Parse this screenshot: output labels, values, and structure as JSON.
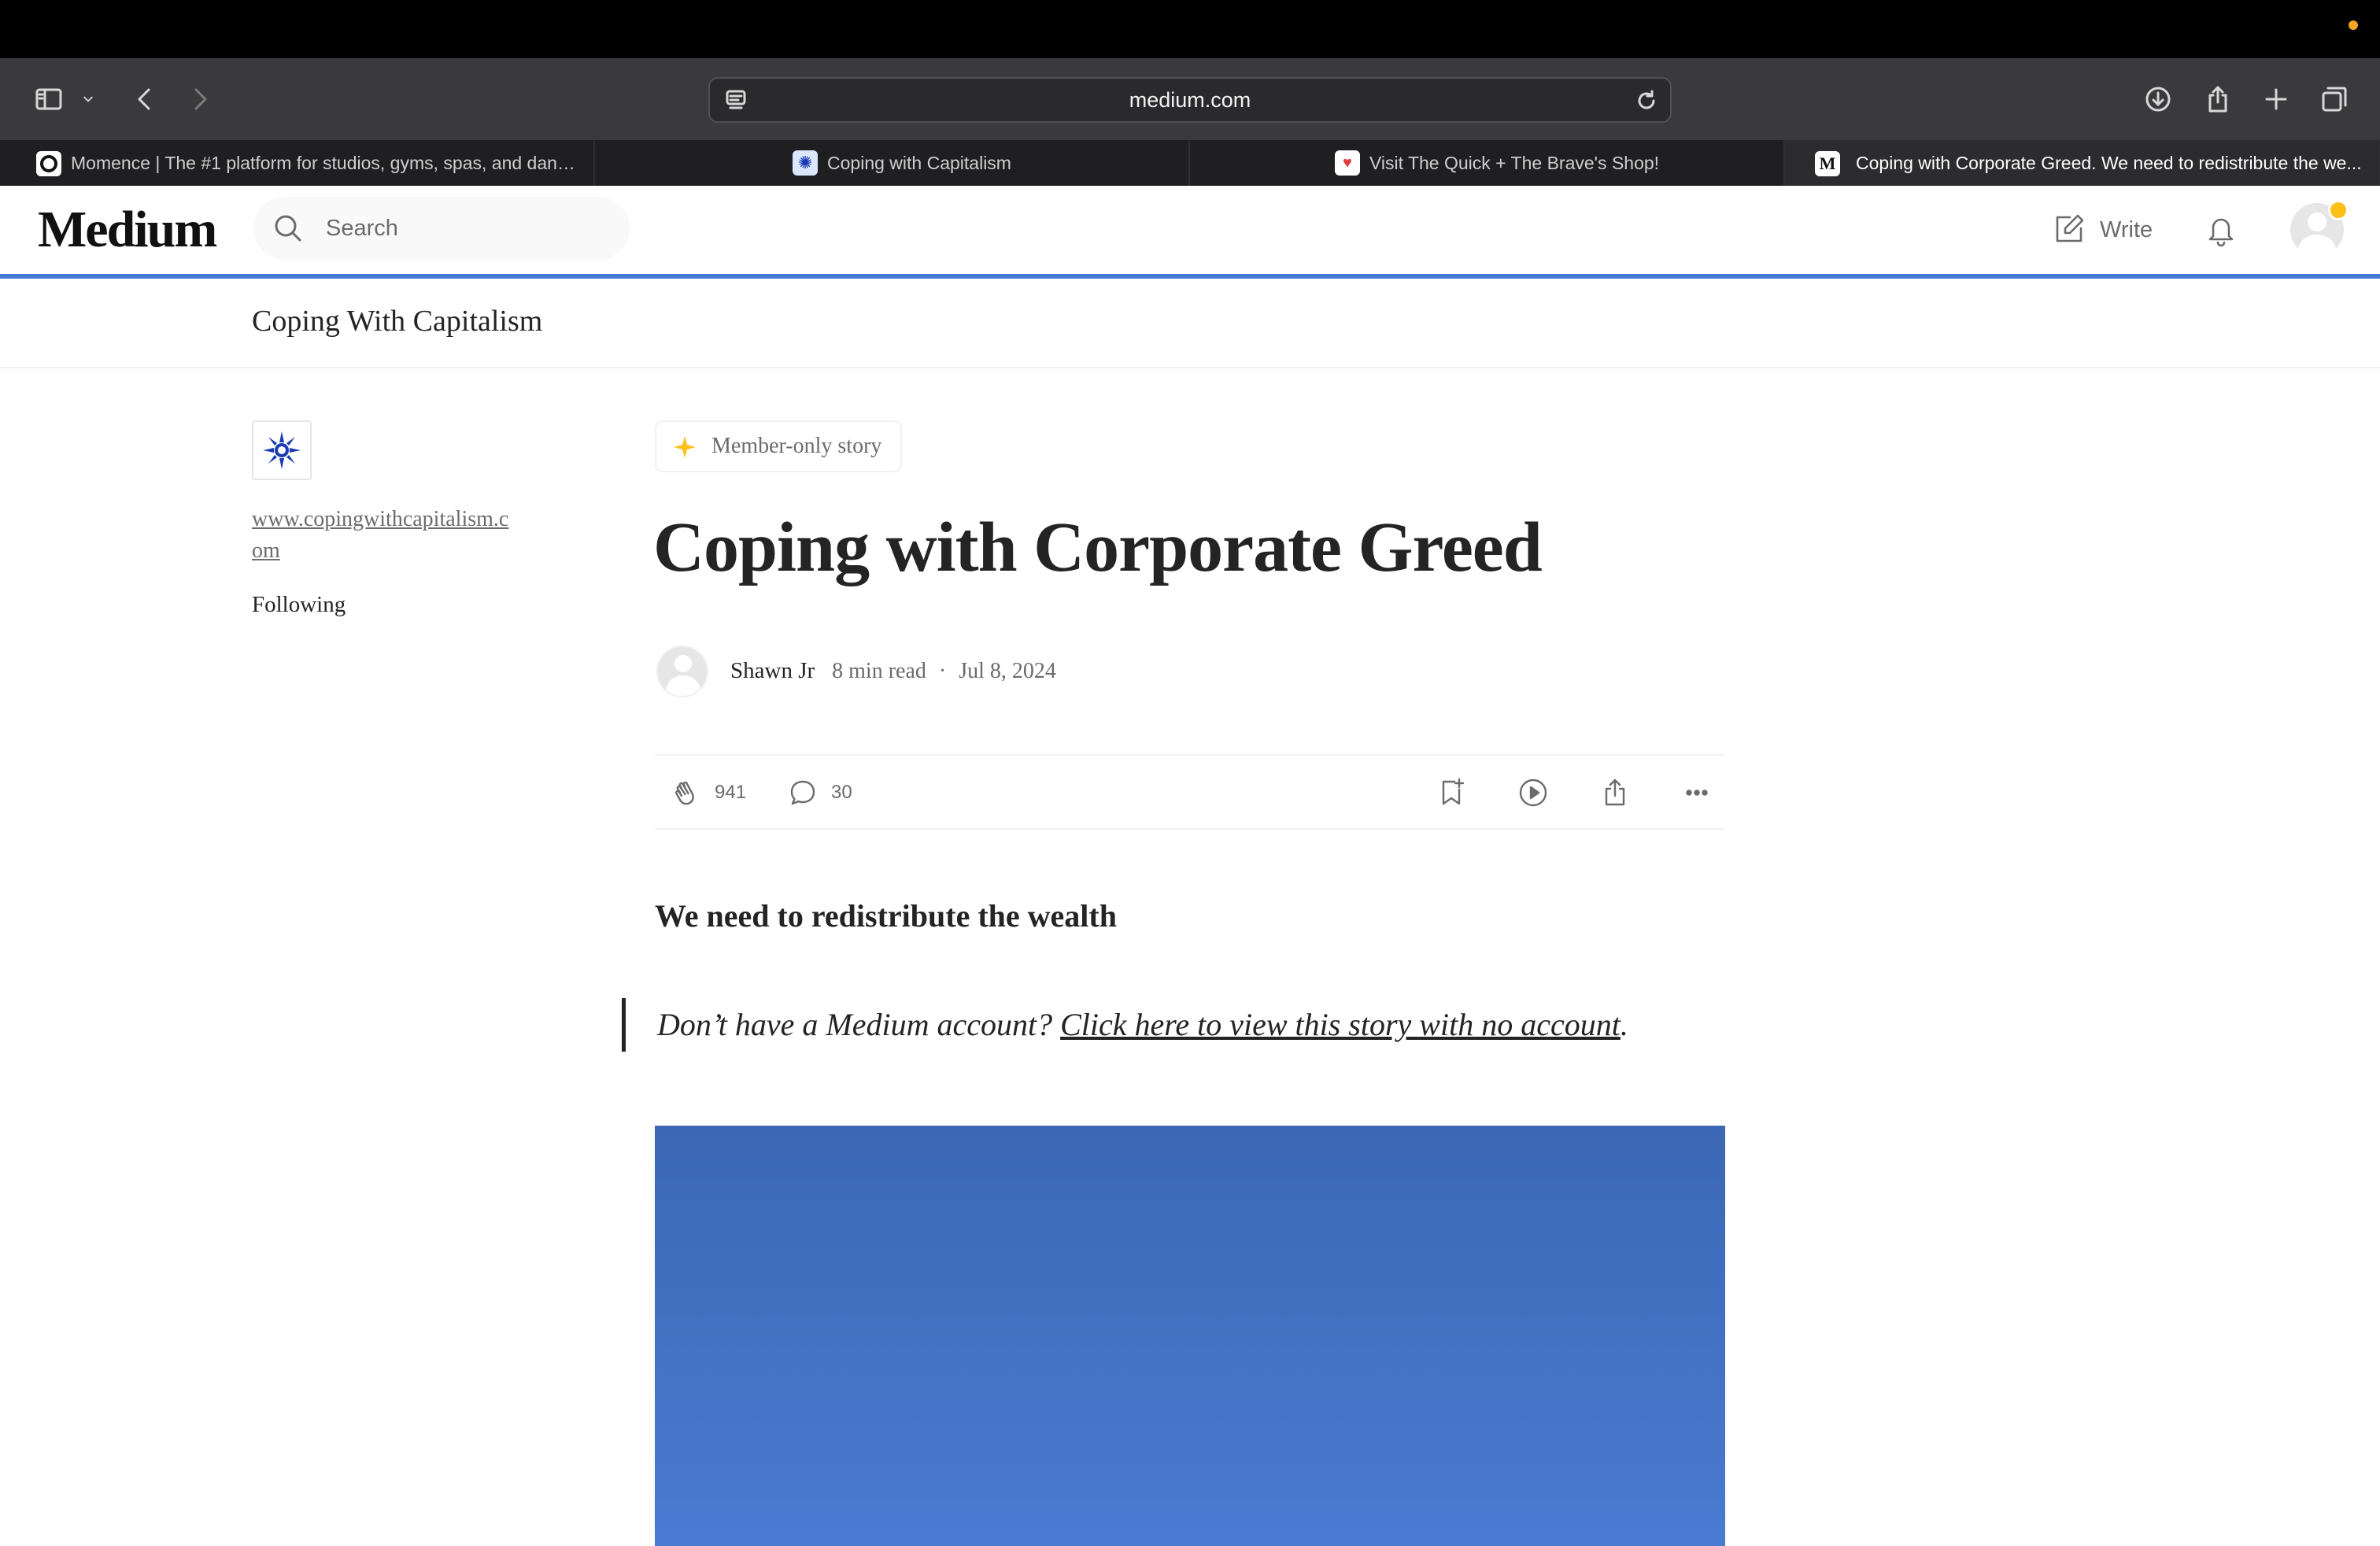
{
  "browser": {
    "url": "medium.com",
    "tabs": [
      {
        "title": "Momence | The #1 platform for studios, gyms, spas, and danc...",
        "favicon": "momence-icon",
        "active": false
      },
      {
        "title": "Coping with Capitalism",
        "favicon": "cwc-icon",
        "active": false
      },
      {
        "title": "Visit The Quick + The Brave's Shop!",
        "favicon": "shop-icon",
        "active": false
      },
      {
        "title": "Coping with Corporate Greed. We need to redistribute the we...",
        "favicon": "medium-icon",
        "active": true
      }
    ]
  },
  "header": {
    "logo": "Medium",
    "search_placeholder": "Search",
    "write_label": "Write"
  },
  "reading_progress": 1.0,
  "publication": {
    "name": "Coping With Capitalism",
    "link": "www.copingwithcapitalism.com",
    "follow_status": "Following"
  },
  "article": {
    "badge": "Member-only story",
    "title": "Coping with Corporate Greed",
    "author": "Shawn Jr",
    "read_time": "8 min read",
    "separator": "·",
    "date": "Jul 8, 2024",
    "claps": "941",
    "responses": "30",
    "subtitle": "We need to redistribute the wealth",
    "quote_prefix": "Don’t have a Medium account? ",
    "quote_link": "Click here to view this story with no account",
    "quote_suffix": "."
  },
  "colors": {
    "accent_progress": "#4a7ad8",
    "member_star": "#ffc017",
    "hero_sky": "#4472c4"
  }
}
